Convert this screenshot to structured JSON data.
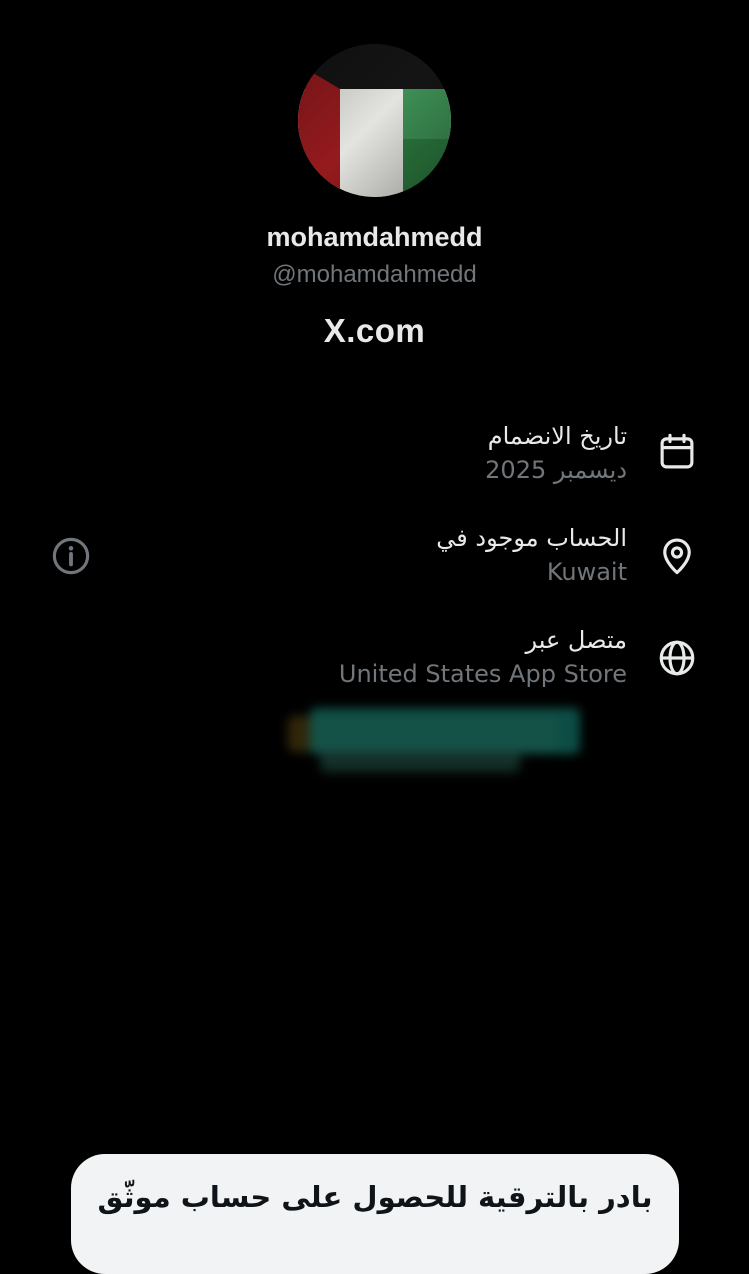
{
  "profile": {
    "display_name": "mohamdahmedd",
    "handle": "@mohamdahmedd",
    "avatar_icon": "kuwait-flag-avatar",
    "brand": "X.com"
  },
  "about": {
    "rows": [
      {
        "title": "تاريخ الانضمام",
        "value": "ديسمبر 2025",
        "icon": "calendar-icon"
      },
      {
        "title": "الحساب موجود في",
        "value": "Kuwait",
        "icon": "location-pin-icon"
      },
      {
        "title": "متصل عبر",
        "value": "United States App Store",
        "icon": "globe-icon"
      }
    ],
    "info_icon": "info-icon"
  },
  "bottom_sheet": {
    "text": "بادر بالترقية للحصول على حساب موثّق"
  },
  "colors": {
    "background": "#000000",
    "primary_text": "#e7e9ea",
    "secondary_text": "#71767b",
    "sheet_background": "#f1f3f4"
  }
}
